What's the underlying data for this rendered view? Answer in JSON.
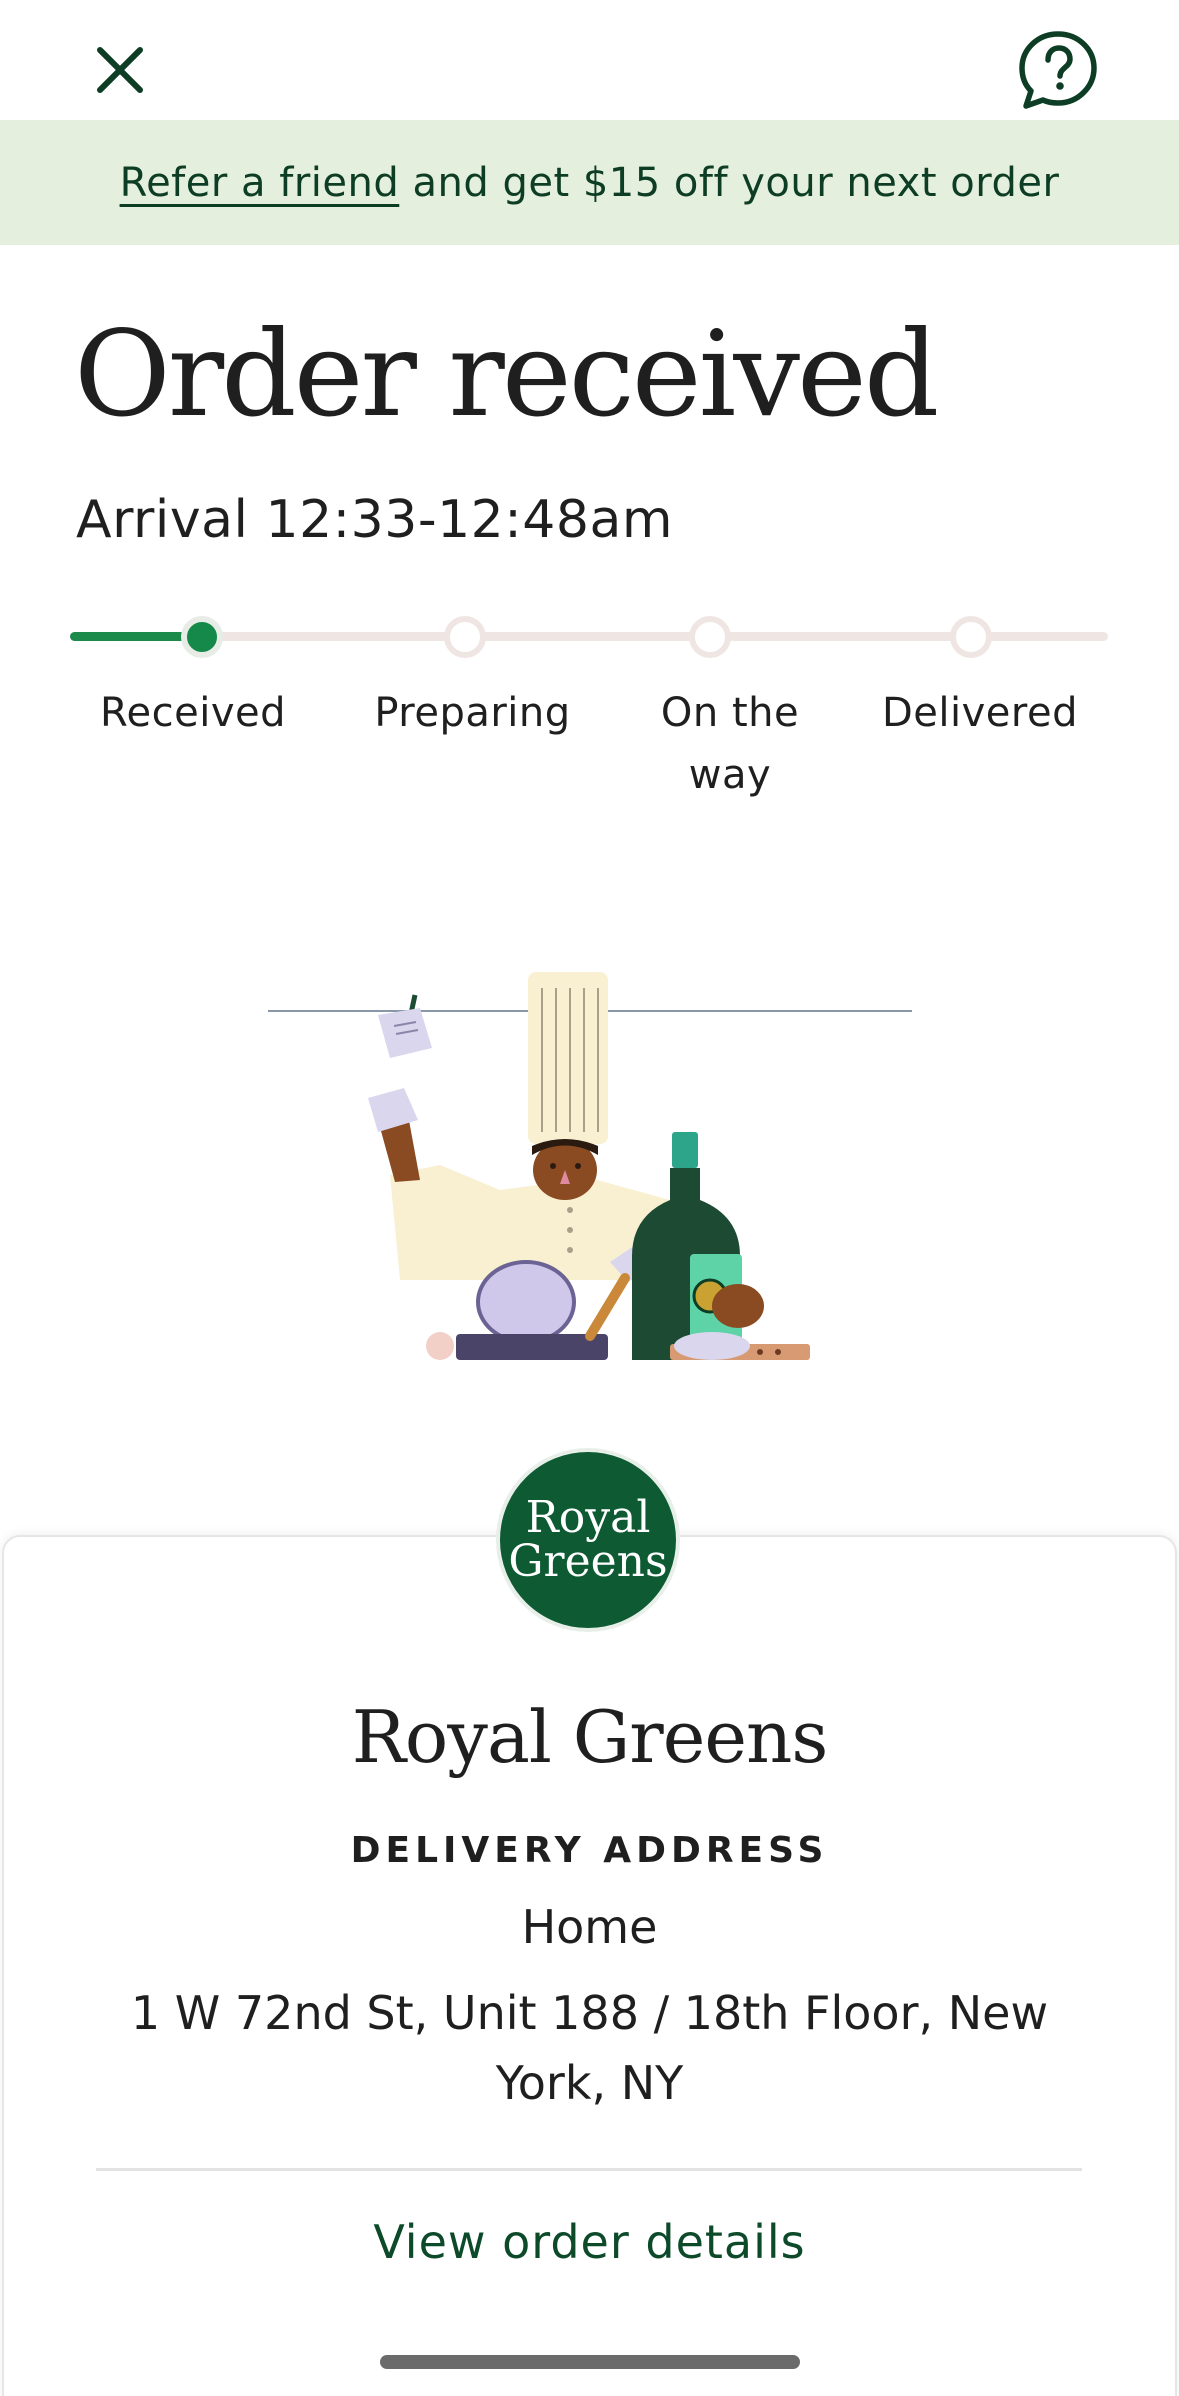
{
  "header": {
    "close_icon": "close-icon",
    "help_icon": "help-question-icon"
  },
  "banner": {
    "link_text": "Refer a friend",
    "rest_text": " and get $15 off your next order"
  },
  "status": {
    "title": "Order received",
    "arrival": "Arrival 12:33-12:48am",
    "current_step": 1,
    "steps": [
      {
        "label": "Received"
      },
      {
        "label": "Preparing"
      },
      {
        "label": "On the way"
      },
      {
        "label": "Delivered"
      }
    ]
  },
  "card": {
    "logo_line1": "Royal",
    "logo_line2": "Greens",
    "restaurant": "Royal Greens",
    "address_label": "DELIVERY ADDRESS",
    "address_name": "Home",
    "address_line": "1 W 72nd St, Unit 188 / 18th Floor, New York, NY",
    "view_details": "View order details"
  },
  "colors": {
    "brand_green": "#0d5a33",
    "progress_green": "#14894a",
    "banner_bg": "#e5efdd"
  }
}
